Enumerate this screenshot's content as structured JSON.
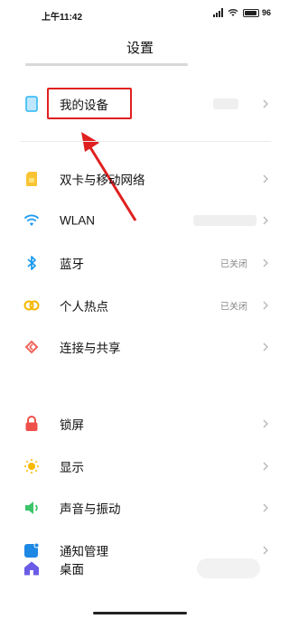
{
  "status_bar": {
    "time": "上午11:42",
    "battery": "96"
  },
  "page": {
    "title": "设置"
  },
  "items": [
    {
      "id": "my-device",
      "label": "我的设备",
      "value": "",
      "icon": "phone-icon",
      "color": "#29b6f6"
    },
    {
      "id": "dual-sim",
      "label": "双卡与移动网络",
      "value": "",
      "icon": "sim-card-icon",
      "color": "#f9c433"
    },
    {
      "id": "wlan",
      "label": "WLAN",
      "value": "",
      "icon": "wifi-icon",
      "color": "#1e9bf0"
    },
    {
      "id": "bluetooth",
      "label": "蓝牙",
      "value": "已关闭",
      "icon": "bluetooth-icon",
      "color": "#1e9bf0"
    },
    {
      "id": "hotspot",
      "label": "个人热点",
      "value": "已关闭",
      "icon": "hotspot-icon",
      "color": "#f5b700"
    },
    {
      "id": "connection-sharing",
      "label": "连接与共享",
      "value": "",
      "icon": "share-icon",
      "color": "#f0645a"
    },
    {
      "id": "lock-screen",
      "label": "锁屏",
      "value": "",
      "icon": "lock-icon",
      "color": "#f0504a"
    },
    {
      "id": "display",
      "label": "显示",
      "value": "",
      "icon": "sun-icon",
      "color": "#f9b800"
    },
    {
      "id": "sound",
      "label": "声音与振动",
      "value": "",
      "icon": "speaker-icon",
      "color": "#3cc46a"
    },
    {
      "id": "notifications",
      "label": "通知管理",
      "value": "",
      "icon": "notification-icon",
      "color": "#1e88e5"
    },
    {
      "id": "desktop",
      "label": "桌面",
      "value": "",
      "icon": "home-icon",
      "color": "#6b5ce7"
    }
  ],
  "annotation": {
    "highlight_color": "#e02020"
  }
}
